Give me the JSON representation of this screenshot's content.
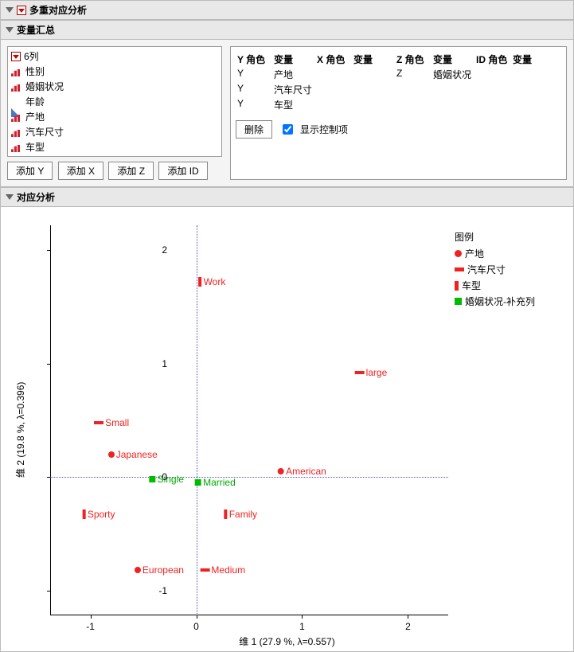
{
  "main_title": "多重对应分析",
  "var_summary": {
    "title": "变量汇总",
    "list_header": "6列",
    "columns": [
      {
        "name": "性别",
        "icon": "bars"
      },
      {
        "name": "婚姻状况",
        "icon": "bars"
      },
      {
        "name": "年龄",
        "icon": "tri"
      },
      {
        "name": "产地",
        "icon": "bars"
      },
      {
        "name": "汽车尺寸",
        "icon": "bars"
      },
      {
        "name": "车型",
        "icon": "bars"
      }
    ],
    "buttons": {
      "addY": "添加 Y",
      "addX": "添加 X",
      "addZ": "添加 Z",
      "addID": "添加 ID"
    },
    "role_headers": {
      "y": "Y 角色",
      "x": "X 角色",
      "z": "Z 角色",
      "id": "ID 角色",
      "var": "变量"
    },
    "assignments": {
      "y": [
        "产地",
        "汽车尺寸",
        "车型"
      ],
      "z": [
        "婚姻状况"
      ]
    },
    "delete_btn": "删除",
    "show_controls": "显示控制项"
  },
  "corr_analysis_title": "对应分析",
  "legend": {
    "title": "图例",
    "items": [
      {
        "marker": "circle",
        "label": "产地"
      },
      {
        "marker": "bar",
        "label": "汽车尺寸"
      },
      {
        "marker": "tall",
        "label": "车型"
      },
      {
        "marker": "square",
        "label": "婚姻状况-补充列"
      }
    ]
  },
  "chart_data": {
    "type": "scatter",
    "xlabel": "维 1  (27.9 %, λ=0.557)",
    "ylabel": "维 2  (19.8 %, λ=0.396)",
    "xlim": [
      -1.38,
      2.38
    ],
    "ylim": [
      -1.22,
      2.22
    ],
    "x_ticks": [
      -1,
      0,
      1,
      2
    ],
    "y_ticks": [
      -1,
      0,
      1,
      2
    ],
    "series": [
      {
        "name": "产地",
        "marker": "circle",
        "color": "#e22",
        "points": [
          {
            "label": "Japanese",
            "x": -0.6,
            "y": 0.2
          },
          {
            "label": "American",
            "x": 1.0,
            "y": 0.05
          },
          {
            "label": "European",
            "x": -0.35,
            "y": -0.82
          }
        ]
      },
      {
        "name": "汽车尺寸",
        "marker": "bar",
        "color": "#e22",
        "points": [
          {
            "label": "Small",
            "x": -0.8,
            "y": 0.48
          },
          {
            "label": "large",
            "x": 1.65,
            "y": 0.92
          },
          {
            "label": "Medium",
            "x": 0.25,
            "y": -0.82
          }
        ]
      },
      {
        "name": "车型",
        "marker": "tall",
        "color": "#e22",
        "points": [
          {
            "label": "Work",
            "x": 0.15,
            "y": 1.72
          },
          {
            "label": "Sporty",
            "x": -0.92,
            "y": -0.33
          },
          {
            "label": "Family",
            "x": 0.42,
            "y": -0.33
          }
        ]
      },
      {
        "name": "婚姻状况-补充列",
        "marker": "square",
        "color": "#0b0",
        "points": [
          {
            "label": "Single",
            "x": -0.28,
            "y": -0.02
          },
          {
            "label": "Married",
            "x": 0.18,
            "y": -0.05
          }
        ]
      }
    ]
  }
}
